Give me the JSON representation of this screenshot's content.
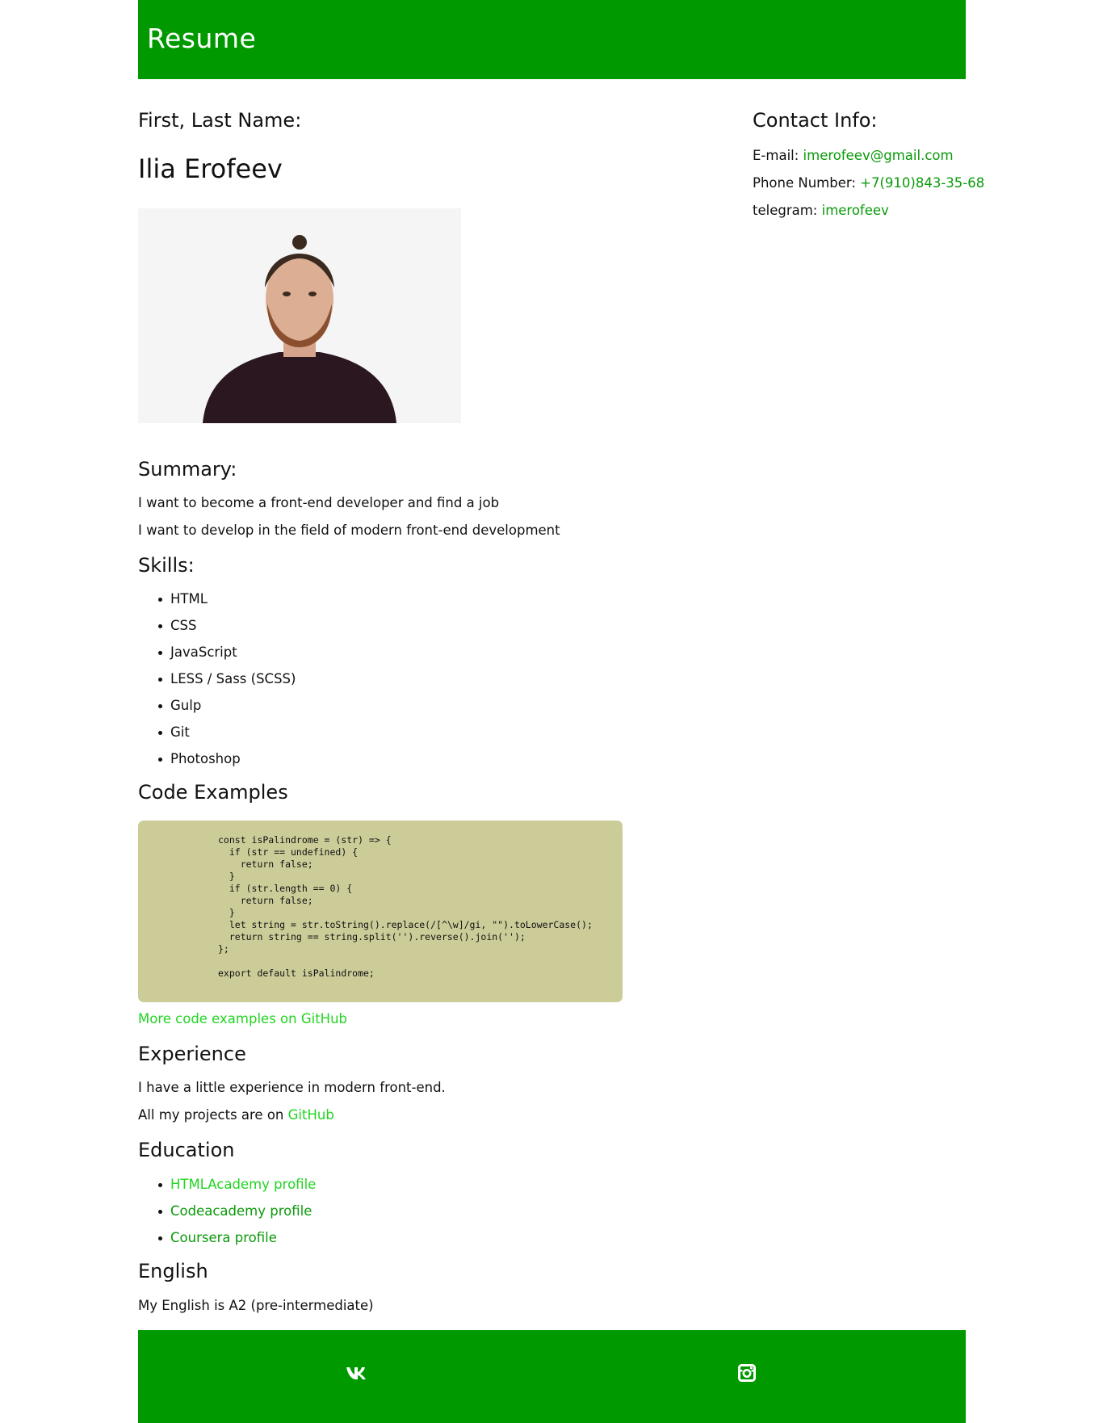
{
  "header": {
    "title": "Resume"
  },
  "left": {
    "name_heading": "First, Last Name:",
    "name": "Ilia Erofeev",
    "summary": {
      "heading": "Summary:",
      "lines": [
        "I want to become a front-end developer and find a job",
        "I want to develop in the field of modern front-end development"
      ]
    },
    "skills": {
      "heading": "Skills:",
      "items": [
        "HTML",
        "CSS",
        "JavaScript",
        "LESS / Sass (SCSS)",
        "Gulp",
        "Git",
        "Photoshop"
      ]
    },
    "code_examples": {
      "heading": "Code Examples",
      "code": "const isPalindrome = (str) => {\n  if (str == undefined) {\n    return false;\n  }\n  if (str.length == 0) {\n    return false;\n  }\n  let string = str.toString().replace(/[^\\w]/gi, \"\").toLowerCase();\n  return string == string.split('').reverse().join('');\n};\n\nexport default isPalindrome;",
      "more_link": "More code examples on GitHub"
    },
    "experience": {
      "heading": "Experience",
      "line1": "I have a little experience in modern front-end.",
      "line2_prefix": "All my projects are on ",
      "line2_link": "GitHub"
    },
    "education": {
      "heading": "Education",
      "items": [
        "HTMLAcademy profile",
        "Codeacademy profile",
        "Coursera profile"
      ]
    },
    "english": {
      "heading": "English",
      "line": "My English is A2 (pre-intermediate)"
    }
  },
  "contact": {
    "heading": "Contact Info:",
    "email_label": "E-mail: ",
    "email": "imerofeev@gmail.com",
    "phone_label": "Phone Number: ",
    "phone": "+7(910)843-35-68",
    "telegram_label": "telegram: ",
    "telegram": "imerofeev"
  },
  "footer": {
    "icons": [
      "vk-icon",
      "instagram-icon"
    ]
  },
  "colors": {
    "brand_green": "#009900",
    "link_green": "#0a9a0a",
    "link_bright_green": "#22d422",
    "code_background": "#cccc99"
  }
}
